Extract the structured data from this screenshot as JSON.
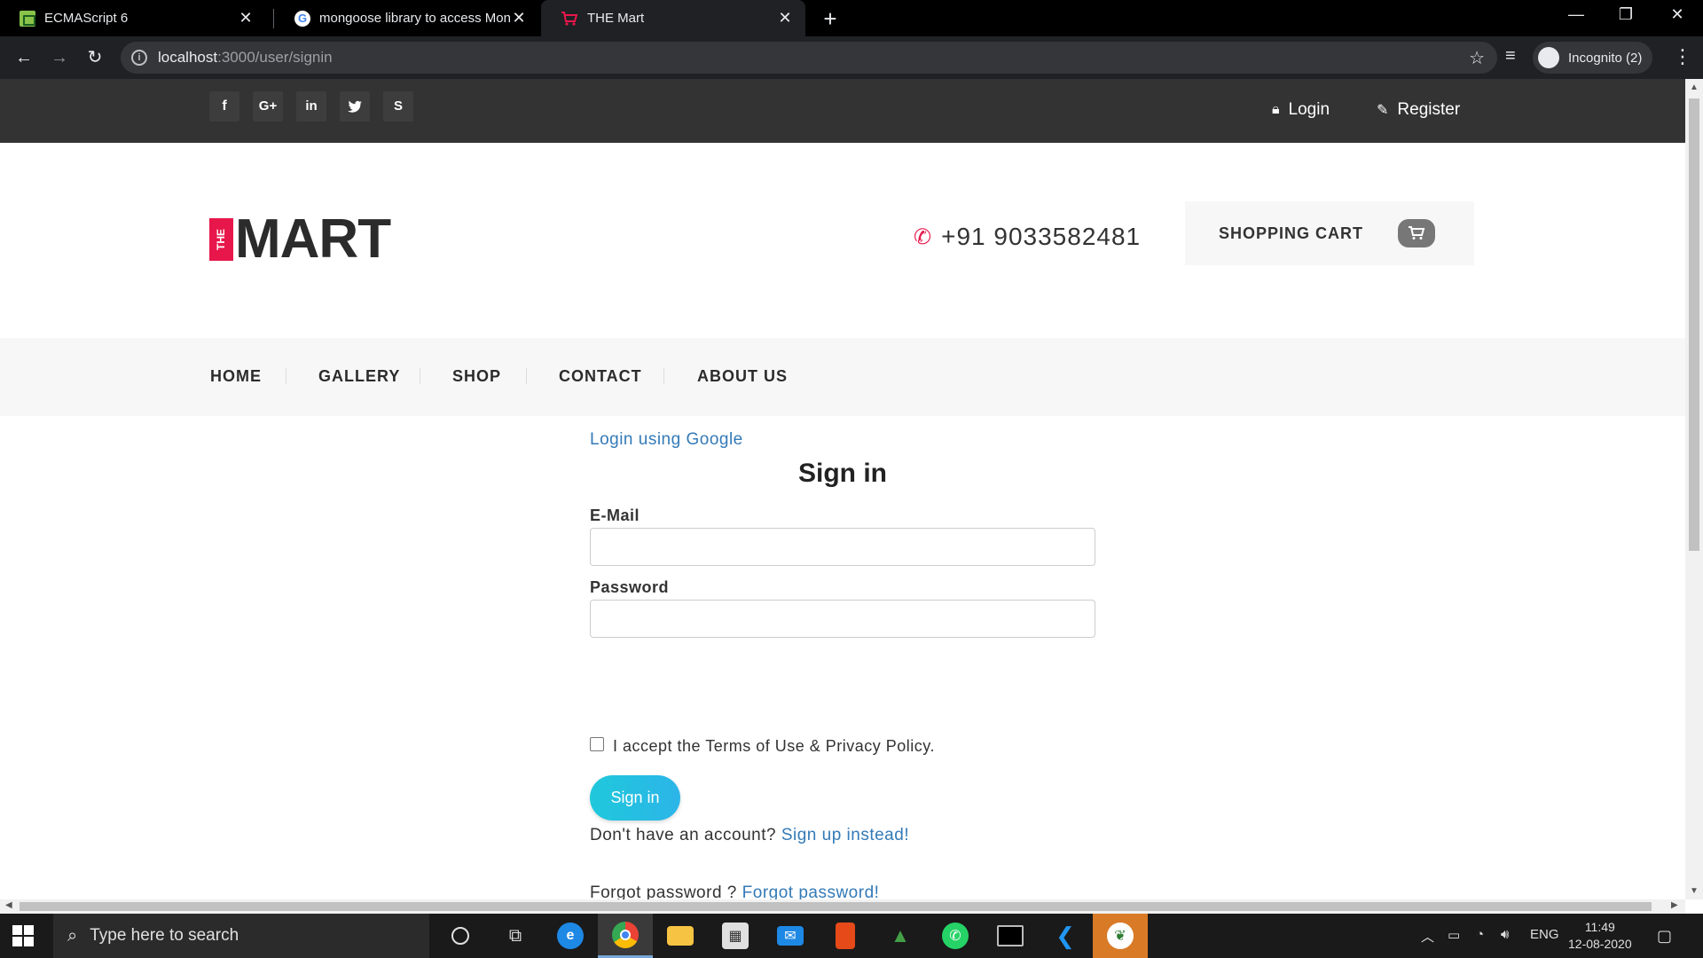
{
  "browser": {
    "tabs": [
      {
        "title": "ECMAScript 6",
        "icon": "w3-icon"
      },
      {
        "title": "mongoose library to access Mon",
        "icon": "google-icon"
      },
      {
        "title": "THE Mart",
        "icon": "cart-icon"
      }
    ],
    "url_host": "localhost",
    "url_path": ":3000/user/signin",
    "profile_label": "Incognito (2)"
  },
  "site": {
    "topbar": {
      "social": [
        "f",
        "G+",
        "in",
        "t",
        "S"
      ],
      "login": "Login",
      "register": "Register"
    },
    "logo": {
      "the": "THE",
      "mart": "MART"
    },
    "phone": "+91 9033582481",
    "cart_label": "SHOPPING CART",
    "nav": [
      "HOME",
      "GALLERY",
      "SHOP",
      "CONTACT",
      "ABOUT US"
    ],
    "accent_color": "#e8174b"
  },
  "form": {
    "google_link": "Login using Google",
    "title": "Sign in",
    "email_label": "E-Mail",
    "email_value": "",
    "password_label": "Password",
    "password_value": "",
    "terms_text": "I accept the Terms of Use & Privacy Policy.",
    "terms_checked": false,
    "submit_label": "Sign in",
    "no_account_text": "Don't have an account?",
    "signup_link": "Sign up instead!",
    "forgot_text": "Forgot password ?",
    "forgot_link": "Forgot password!"
  },
  "taskbar": {
    "search_placeholder": "Type here to search",
    "language": "ENG",
    "time": "11:49",
    "date": "12-08-2020"
  }
}
